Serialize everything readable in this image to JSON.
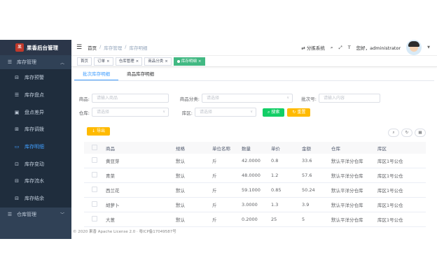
{
  "sidebar": {
    "logo_text": "果香后台管理",
    "logo_mark": "果",
    "group1": "库存管理",
    "items": [
      {
        "label": "库存预警",
        "icon": "warning-icon"
      },
      {
        "label": "库存盘点",
        "icon": "stocktake-icon"
      },
      {
        "label": "盘点差异",
        "icon": "diff-icon"
      },
      {
        "label": "库存调拨",
        "icon": "transfer-icon"
      },
      {
        "label": "库存明细",
        "icon": "detail-icon"
      },
      {
        "label": "库存变动",
        "icon": "change-icon"
      },
      {
        "label": "库存流水",
        "icon": "flow-icon"
      },
      {
        "label": "库存结余",
        "icon": "balance-icon"
      }
    ],
    "group2": "仓库管理"
  },
  "header": {
    "breadcrumb": [
      "首页",
      "库存管理",
      "库存明细"
    ],
    "switch_system": "分拣系统",
    "greeting": "您好，administrator"
  },
  "tags": [
    "首页",
    "订单",
    "仓库管理",
    "商品分类",
    "库存明细"
  ],
  "tabs": [
    "批次库存明细",
    "商品库存明细"
  ],
  "form": {
    "goods_label": "商品:",
    "goods_placeholder": "请输入商品",
    "category_label": "商品分类:",
    "category_placeholder": "请选择",
    "batch_label": "批次号:",
    "batch_placeholder": "请输入内容",
    "warehouse_label": "仓库:",
    "warehouse_placeholder": "请选择",
    "area_label": "库区:",
    "area_placeholder": "请选择",
    "search": "搜索",
    "reset": "重置"
  },
  "export_label": "导出",
  "table": {
    "headers": [
      "商品",
      "规格",
      "单位名称",
      "数量",
      "单价",
      "金额",
      "仓库",
      "库区"
    ],
    "rows": [
      [
        "黄豆芽",
        "默认",
        "斤",
        "42.0000",
        "0.8",
        "33.6",
        "默认平洋分仓库",
        "库区1号公仓"
      ],
      [
        "青菜",
        "默认",
        "斤",
        "48.0000",
        "1.2",
        "57.6",
        "默认平洋分仓库",
        "库区1号公仓"
      ],
      [
        "西兰花",
        "默认",
        "斤",
        "59.1000",
        "0.85",
        "50.24",
        "默认平洋分仓库",
        "库区1号公仓"
      ],
      [
        "胡萝卜",
        "默认",
        "斤",
        "3.0000",
        "1.3",
        "3.9",
        "默认平洋分仓库",
        "库区1号公仓"
      ],
      [
        "大葱",
        "默认",
        "斤",
        "0.2000",
        "25",
        "5",
        "默认平洋分仓库",
        "库区1号公仓"
      ]
    ]
  },
  "footer": "© 2020 果香 Apache License 2.0 · 粤ICP备17049587号",
  "colors": {
    "sidebar": "#304156",
    "active": "#409eff",
    "tag_active": "#42b983",
    "search": "#13ce66",
    "reset": "#ffba00"
  }
}
